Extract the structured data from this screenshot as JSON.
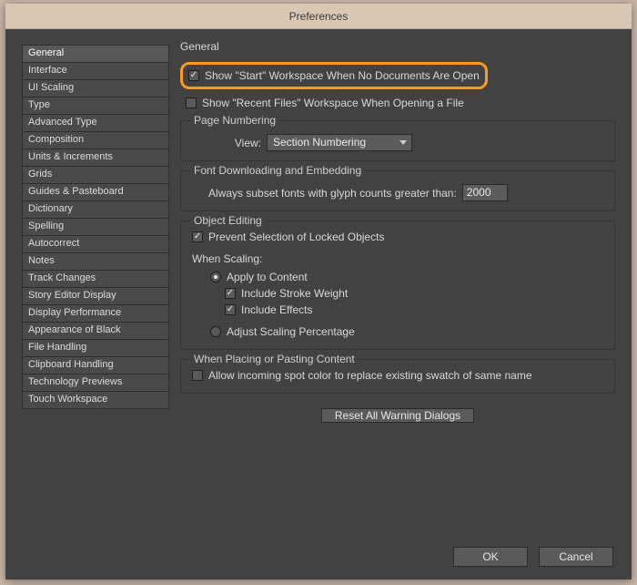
{
  "window": {
    "title": "Preferences"
  },
  "sidebar": {
    "items": [
      "General",
      "Interface",
      "UI Scaling",
      "Type",
      "Advanced Type",
      "Composition",
      "Units & Increments",
      "Grids",
      "Guides & Pasteboard",
      "Dictionary",
      "Spelling",
      "Autocorrect",
      "Notes",
      "Track Changes",
      "Story Editor Display",
      "Display Performance",
      "Appearance of Black",
      "File Handling",
      "Clipboard Handling",
      "Technology Previews",
      "Touch Workspace"
    ],
    "selectedIndex": 0
  },
  "main": {
    "heading": "General",
    "showStart": {
      "label": "Show \"Start\" Workspace When No Documents Are Open",
      "checked": true
    },
    "showRecent": {
      "label": "Show \"Recent Files\" Workspace When Opening a File",
      "checked": false
    },
    "pageNumbering": {
      "legend": "Page Numbering",
      "viewLabel": "View:",
      "viewValue": "Section Numbering"
    },
    "fontDownloading": {
      "legend": "Font Downloading and Embedding",
      "subsetLabel": "Always subset fonts with glyph counts greater than:",
      "subsetValue": "2000"
    },
    "objectEditing": {
      "legend": "Object Editing",
      "preventSelection": {
        "label": "Prevent Selection of Locked Objects",
        "checked": true
      },
      "whenScalingLabel": "When Scaling:",
      "applyToContent": {
        "label": "Apply to Content",
        "checked": true
      },
      "includeStroke": {
        "label": "Include Stroke Weight",
        "checked": true
      },
      "includeEffects": {
        "label": "Include Effects",
        "checked": true
      },
      "adjustScaling": {
        "label": "Adjust Scaling Percentage",
        "checked": false
      }
    },
    "placingPasting": {
      "legend": "When Placing or Pasting Content",
      "allowSwatch": {
        "label": "Allow incoming spot color to replace existing swatch of same name",
        "checked": false
      }
    },
    "resetButton": "Reset All Warning Dialogs"
  },
  "footer": {
    "ok": "OK",
    "cancel": "Cancel"
  }
}
